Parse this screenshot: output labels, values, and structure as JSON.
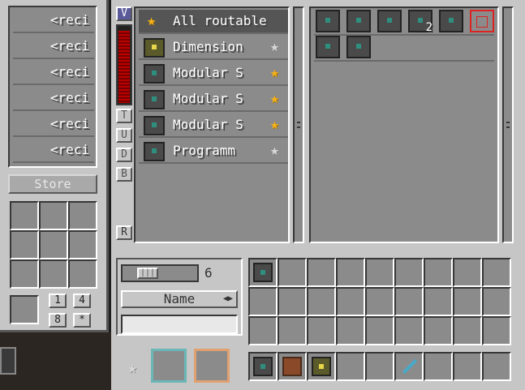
{
  "recipes": {
    "items": [
      {
        "label": "<reci"
      },
      {
        "label": "<reci"
      },
      {
        "label": "<reci"
      },
      {
        "label": "<reci"
      },
      {
        "label": "<reci"
      },
      {
        "label": "<reci"
      }
    ],
    "store_label": "Store",
    "count_buttons": [
      "1",
      "4",
      "8",
      "*"
    ]
  },
  "side_buttons": [
    "V",
    "T",
    "U",
    "D",
    "B",
    "R"
  ],
  "energy": {
    "level_fraction": 0.95
  },
  "routers": [
    {
      "label": "All routable",
      "star": "gold",
      "selected": true,
      "icon": "none"
    },
    {
      "label": "Dimension",
      "star": "grey",
      "selected": false,
      "icon": "dim"
    },
    {
      "label": "Modular S",
      "star": "gold",
      "selected": false,
      "icon": "block"
    },
    {
      "label": "Modular S",
      "star": "gold",
      "selected": false,
      "icon": "block"
    },
    {
      "label": "Modular S",
      "star": "gold",
      "selected": false,
      "icon": "block"
    },
    {
      "label": "Programm",
      "star": "grey",
      "selected": false,
      "icon": "block"
    }
  ],
  "items_panel": {
    "row1": [
      {
        "icon": "storage-block-icon",
        "count": ""
      },
      {
        "icon": "storage-block-icon",
        "count": ""
      },
      {
        "icon": "storage-block-icon",
        "count": ""
      },
      {
        "icon": "storage-block-icon",
        "count": "2"
      },
      {
        "icon": "storage-block-icon",
        "count": ""
      },
      {
        "icon": "wire-cube-icon",
        "count": ""
      }
    ],
    "row2": [
      {
        "icon": "storage-block-icon",
        "count": ""
      },
      {
        "icon": "storage-block-icon",
        "count": ""
      }
    ]
  },
  "filter": {
    "slider_value": "6",
    "sort_label": "Name",
    "sort_arrow": "◀▶",
    "search_value": ""
  },
  "inventory": {
    "main_first_item": "storage-block-icon",
    "hotbar": [
      "storage-block-icon",
      "dirt-block-icon",
      "dimension-block-icon",
      "",
      "",
      "wrench-icon",
      "",
      "",
      ""
    ]
  },
  "icons": {
    "star_gold": "★",
    "star_grey": "★",
    "slider_knob": "|||"
  }
}
